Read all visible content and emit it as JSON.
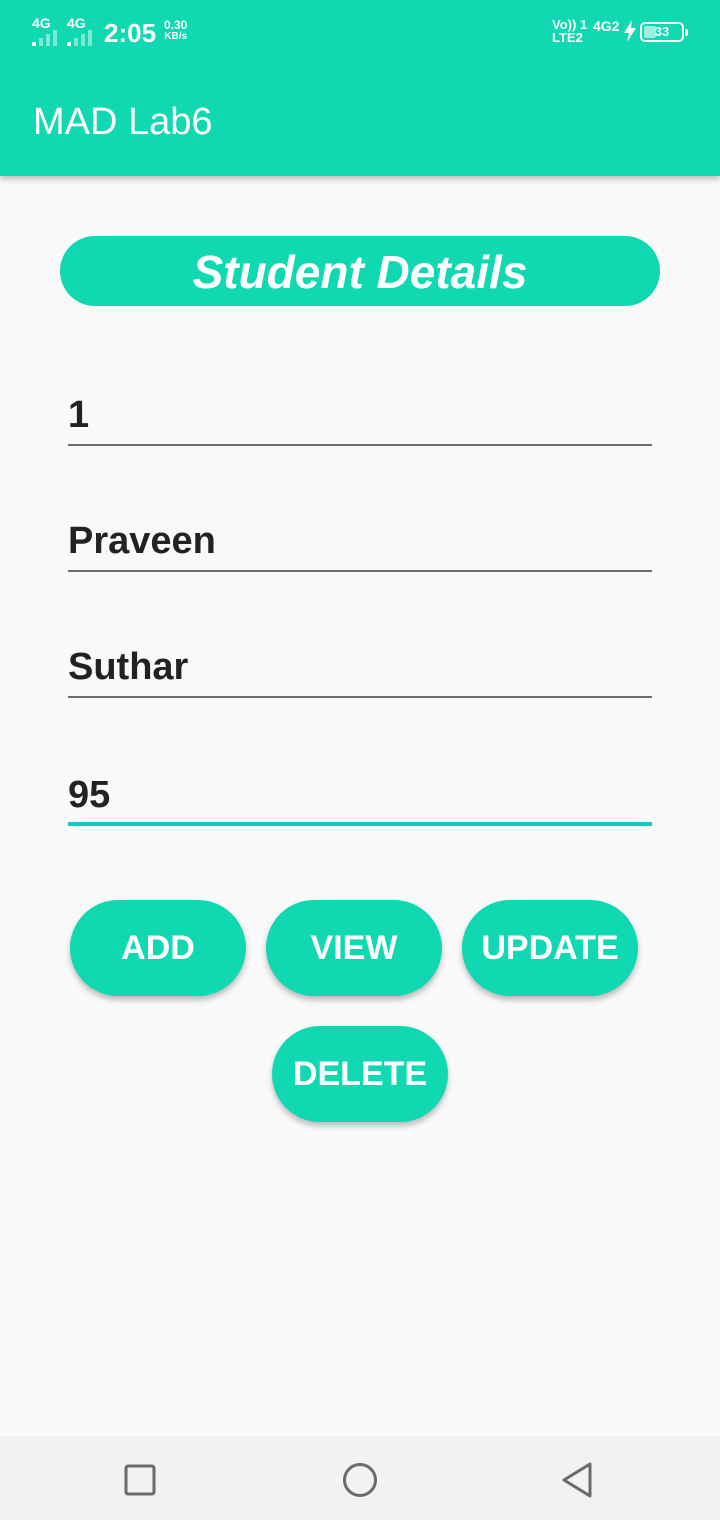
{
  "status_bar": {
    "sim1_type": "4G",
    "sim2_type": "4G",
    "time": "2:05",
    "speed_value": "0.30",
    "speed_unit": "KB/s",
    "volte_top": "Vo)) 1",
    "volte_bottom": "LTE2",
    "network_right": "4G2",
    "battery_percent": "33"
  },
  "app_bar": {
    "title": "MAD Lab6"
  },
  "form": {
    "heading": "Student Details",
    "fields": [
      {
        "value": "1"
      },
      {
        "value": "Praveen"
      },
      {
        "value": "Suthar"
      },
      {
        "value": "95"
      }
    ]
  },
  "buttons": {
    "add": "ADD",
    "view": "VIEW",
    "update": "UPDATE",
    "delete": "DELETE"
  },
  "colors": {
    "accent": "#10d8b0",
    "focus_underline": "#10c9c0",
    "background": "#f9f9f9"
  },
  "icons": {
    "recents": "square-icon",
    "home": "circle-icon",
    "back": "triangle-back-icon"
  }
}
